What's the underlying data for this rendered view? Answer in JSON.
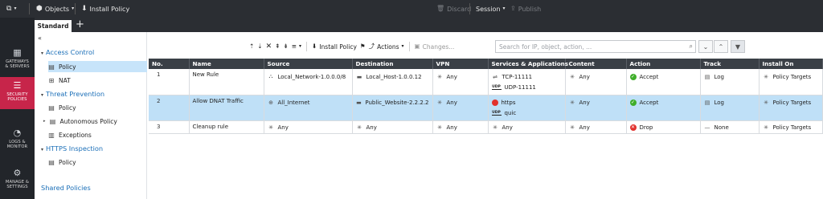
{
  "topbar": {
    "objects_label": "Objects",
    "install_policy_label": "Install Policy",
    "discard_label": "Discard",
    "session_label": "Session",
    "publish_label": "Publish"
  },
  "leftnav": [
    {
      "id": "gateways",
      "line1": "GATEWAYS",
      "line2": "& SERVERS"
    },
    {
      "id": "security",
      "line1": "SECURITY",
      "line2": "POLICIES"
    },
    {
      "id": "logs",
      "line1": "LOGS &",
      "line2": "MONITOR"
    },
    {
      "id": "manage",
      "line1": "MANAGE &",
      "line2": "SETTINGS"
    }
  ],
  "tabs": {
    "active": "Standard",
    "add": "+"
  },
  "tree": {
    "access_control": "Access Control",
    "policy": "Policy",
    "nat": "NAT",
    "threat_prevention": "Threat Prevention",
    "tp_policy": "Policy",
    "autonomous_policy": "Autonomous Policy",
    "exceptions": "Exceptions",
    "https_inspection": "HTTPS Inspection",
    "https_policy": "Policy",
    "shared_policies": "Shared Policies"
  },
  "toolbar": {
    "install_policy": "Install Policy",
    "actions": "Actions",
    "changes": "Changes...",
    "search_placeholder": "Search for IP, object, action, ..."
  },
  "table": {
    "headers": [
      "No.",
      "Name",
      "Source",
      "Destination",
      "VPN",
      "Services & Applications",
      "Content",
      "Action",
      "Track",
      "Install On"
    ],
    "rows": [
      {
        "no": "1",
        "name": "New Rule",
        "source": "Local_Network-1.0.0.0/8",
        "destination": "Local_Host-1.0.0.12",
        "vpn": "Any",
        "services": [
          "TCP-11111",
          "UDP-11111"
        ],
        "content": "Any",
        "action": "Accept",
        "track": "Log",
        "install_on": "Policy Targets"
      },
      {
        "no": "2",
        "name": "Allow DNAT Traffic",
        "source": "All_Internet",
        "destination": "Public_Website-2.2.2.2",
        "vpn": "Any",
        "services": [
          "https",
          "quic"
        ],
        "content": "Any",
        "action": "Accept",
        "track": "Log",
        "install_on": "Policy Targets"
      },
      {
        "no": "3",
        "name": "Cleanup rule",
        "source": "Any",
        "destination": "Any",
        "vpn": "Any",
        "services": [
          "Any"
        ],
        "content": "Any",
        "action": "Drop",
        "track": "None",
        "install_on": "Policy Targets"
      }
    ]
  },
  "colors": {
    "topbar_bg": "#2b2e33",
    "nav_active": "#c7254a",
    "tree_link": "#1b6fb8",
    "selection": "#bfe0f7",
    "accept": "#3fae2a",
    "drop": "#e2312d"
  }
}
